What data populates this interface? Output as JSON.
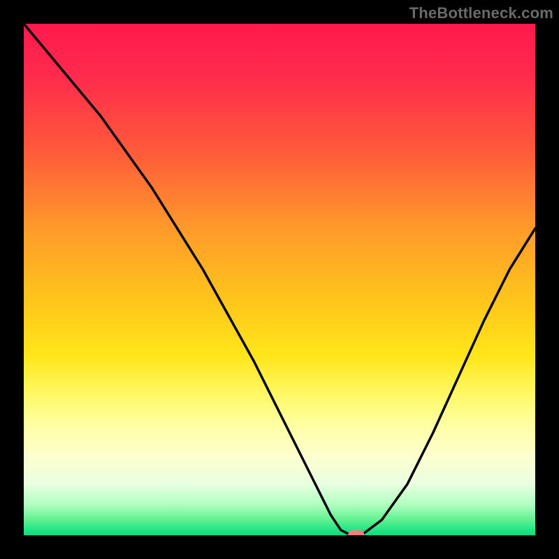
{
  "watermark": "TheBottleneck.com",
  "chart_data": {
    "type": "line",
    "title": "",
    "xlabel": "",
    "ylabel": "",
    "xlim": [
      0,
      100
    ],
    "ylim": [
      0,
      100
    ],
    "grid": false,
    "legend": false,
    "background": "rainbow-gradient (red top to green bottom)",
    "series": [
      {
        "name": "bottleneck-curve",
        "x": [
          0,
          5,
          10,
          15,
          20,
          25,
          30,
          35,
          40,
          45,
          50,
          55,
          60,
          62,
          64,
          66,
          70,
          75,
          80,
          85,
          90,
          95,
          100
        ],
        "y": [
          100,
          94,
          88,
          82,
          75,
          68,
          60,
          52,
          43,
          34,
          24,
          14,
          4,
          1,
          0,
          0,
          3,
          10,
          20,
          31,
          42,
          52,
          60
        ]
      }
    ],
    "annotations": [
      {
        "name": "minimum-marker",
        "x": 65,
        "y": 0,
        "shape": "pill",
        "color": "#ff7a7a"
      }
    ]
  }
}
